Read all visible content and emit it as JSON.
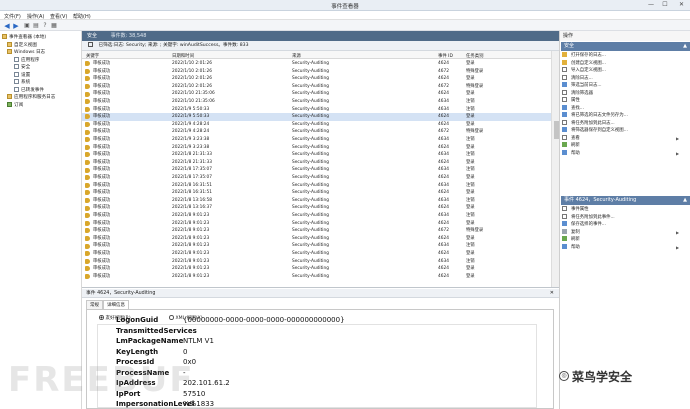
{
  "window": {
    "title": "事件查看器",
    "min": "—",
    "max": "☐",
    "close": "✕"
  },
  "menu": [
    "文件(F)",
    "操作(A)",
    "查看(V)",
    "帮助(H)"
  ],
  "tree": [
    {
      "label": "事件查看器 (本地)",
      "icon": "folder"
    },
    {
      "label": "自定义视图",
      "icon": "folder"
    },
    {
      "label": "Windows 日志",
      "icon": "folder"
    },
    {
      "label": "应用程序",
      "icon": "log"
    },
    {
      "label": "安全",
      "icon": "log"
    },
    {
      "label": "设置",
      "icon": "log"
    },
    {
      "label": "系统",
      "icon": "log"
    },
    {
      "label": "已转发事件",
      "icon": "log"
    },
    {
      "label": "应用程序和服务日志",
      "icon": "folder"
    },
    {
      "label": "订阅",
      "icon": "star"
    }
  ],
  "center": {
    "title": "安全",
    "count": "事件数: 38,548",
    "filter": "已筛选:日志: Security; 来源: ; 关键字: winAuditSuccess。事件数: 833"
  },
  "grid": {
    "columns": [
      "关键字",
      "日期和时间",
      "来源",
      "事件 ID",
      "任务类别"
    ],
    "rows": [
      [
        "审核成功",
        "2022/1/10 2:01:26",
        "Security-Auditing",
        "4624",
        "登录"
      ],
      [
        "审核成功",
        "2022/1/10 2:01:26",
        "Security-Auditing",
        "4672",
        "特殊登录"
      ],
      [
        "审核成功",
        "2022/1/10 2:01:26",
        "Security-Auditing",
        "4624",
        "登录"
      ],
      [
        "审核成功",
        "2022/1/10 2:01:26",
        "Security-Auditing",
        "4672",
        "特殊登录"
      ],
      [
        "审核成功",
        "2022/1/10 21:35:06",
        "Security-Auditing",
        "4624",
        "登录"
      ],
      [
        "审核成功",
        "2022/1/10 21:35:06",
        "Security-Auditing",
        "4634",
        "注销"
      ],
      [
        "审核成功",
        "2022/1/9 5:50:33",
        "Security-Auditing",
        "4634",
        "注销"
      ],
      [
        "审核成功",
        "2022/1/9 5:50:33",
        "Security-Auditing",
        "4624",
        "登录"
      ],
      [
        "审核成功",
        "2022/1/9 4:28:24",
        "Security-Auditing",
        "4624",
        "登录"
      ],
      [
        "审核成功",
        "2022/1/9 4:28:24",
        "Security-Auditing",
        "4672",
        "特殊登录"
      ],
      [
        "审核成功",
        "2022/1/9 3:23:38",
        "Security-Auditing",
        "4634",
        "注销"
      ],
      [
        "审核成功",
        "2022/1/9 3:23:38",
        "Security-Auditing",
        "4624",
        "登录"
      ],
      [
        "审核成功",
        "2022/1/8 21:31:33",
        "Security-Auditing",
        "4634",
        "注销"
      ],
      [
        "审核成功",
        "2022/1/8 21:31:33",
        "Security-Auditing",
        "4624",
        "登录"
      ],
      [
        "审核成功",
        "2022/1/8 17:35:07",
        "Security-Auditing",
        "4634",
        "注销"
      ],
      [
        "审核成功",
        "2022/1/8 17:35:07",
        "Security-Auditing",
        "4624",
        "登录"
      ],
      [
        "审核成功",
        "2022/1/8 16:31:51",
        "Security-Auditing",
        "4634",
        "注销"
      ],
      [
        "审核成功",
        "2022/1/8 16:31:51",
        "Security-Auditing",
        "4624",
        "登录"
      ],
      [
        "审核成功",
        "2022/1/8 13:16:58",
        "Security-Auditing",
        "4634",
        "注销"
      ],
      [
        "审核成功",
        "2022/1/8 13:16:37",
        "Security-Auditing",
        "4624",
        "登录"
      ],
      [
        "审核成功",
        "2022/1/8 9:01:23",
        "Security-Auditing",
        "4634",
        "注销"
      ],
      [
        "审核成功",
        "2022/1/8 9:01:23",
        "Security-Auditing",
        "4624",
        "登录"
      ],
      [
        "审核成功",
        "2022/1/8 9:01:23",
        "Security-Auditing",
        "4672",
        "特殊登录"
      ],
      [
        "审核成功",
        "2022/1/8 9:01:23",
        "Security-Auditing",
        "4624",
        "登录"
      ],
      [
        "审核成功",
        "2022/1/8 9:01:23",
        "Security-Auditing",
        "4634",
        "注销"
      ],
      [
        "审核成功",
        "2022/1/8 9:01:23",
        "Security-Auditing",
        "4624",
        "登录"
      ],
      [
        "审核成功",
        "2022/1/8 9:01:23",
        "Security-Auditing",
        "4634",
        "注销"
      ],
      [
        "审核成功",
        "2022/1/8 9:01:23",
        "Security-Auditing",
        "4624",
        "登录"
      ],
      [
        "审核成功",
        "2022/1/8 9:01:23",
        "Security-Auditing",
        "4624",
        "登录"
      ]
    ],
    "selected_index": 7
  },
  "detail": {
    "title": "事件 4624，Security-Auditing",
    "close": "✕",
    "tabs": [
      "常规",
      "详细信息"
    ],
    "radio_friendly": "友好视图(R)",
    "radio_xml": "XML 视图(X)",
    "fields": [
      {
        "k": "LogonGuid",
        "v": "{00000000-0000-0000-0000-000000000000}"
      },
      {
        "k": "TransmittedServices",
        "v": "-"
      },
      {
        "k": "LmPackageName",
        "v": "NTLM V1"
      },
      {
        "k": "KeyLength",
        "v": "0"
      },
      {
        "k": "ProcessId",
        "v": "0x0"
      },
      {
        "k": "ProcessName",
        "v": "-"
      },
      {
        "k": "IpAddress",
        "v": "202.101.61.2"
      },
      {
        "k": "IpPort",
        "v": "57510"
      },
      {
        "k": "ImpersonationLevel",
        "v": "%%1833"
      }
    ]
  },
  "actions": {
    "title": "操作",
    "section1": "安全",
    "items1": [
      {
        "label": "打开保存的日志...",
        "icon": "y"
      },
      {
        "label": "创建自定义视图...",
        "icon": "y"
      },
      {
        "label": "导入自定义视图...",
        "icon": "w"
      },
      {
        "label": "清除日志...",
        "icon": "w"
      },
      {
        "label": "筛选当前日志...",
        "icon": "b"
      },
      {
        "label": "清除筛选器",
        "icon": "w"
      },
      {
        "label": "属性",
        "icon": "w"
      },
      {
        "label": "查找...",
        "icon": "b"
      },
      {
        "label": "将已筛选的日志文件另存为...",
        "icon": "b"
      },
      {
        "label": "将任务附加到此日志...",
        "icon": "w"
      },
      {
        "label": "将筛选器保存到自定义视图...",
        "icon": "b"
      },
      {
        "label": "查看",
        "icon": "w",
        "sub": "▶"
      },
      {
        "label": "刷新",
        "icon": "g"
      },
      {
        "label": "帮助",
        "icon": "b",
        "sub": "▶"
      }
    ],
    "section2": "事件 4624，Security-Auditing",
    "items2": [
      {
        "label": "事件属性",
        "icon": "w"
      },
      {
        "label": "将任务附加到此事件...",
        "icon": "w"
      },
      {
        "label": "保存选择的事件...",
        "icon": "b"
      },
      {
        "label": "复制",
        "icon": "gr",
        "sub": "▶"
      },
      {
        "label": "刷新",
        "icon": "g"
      },
      {
        "label": "帮助",
        "icon": "b",
        "sub": "▶"
      }
    ]
  },
  "watermarks": {
    "left": "FREEBUF",
    "right": "菜鸟学安全"
  }
}
